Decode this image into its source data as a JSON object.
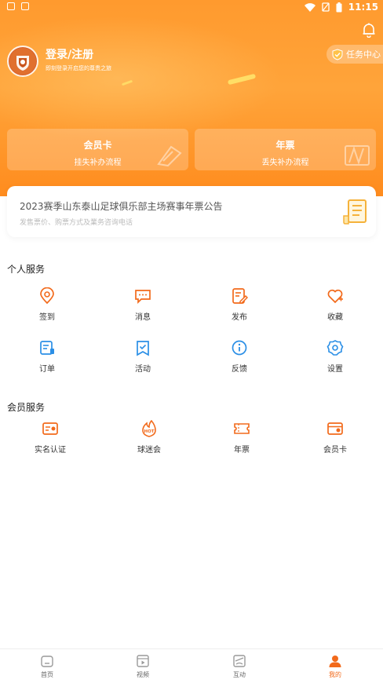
{
  "status_bar": {
    "time": "11:15"
  },
  "profile": {
    "login_label": "登录/注册",
    "subtitle": "即刻登录开启您的尊贵之旅"
  },
  "task_center": {
    "label": "任务中心"
  },
  "hero_cards": [
    {
      "title": "会员卡",
      "subtitle": "挂失补办流程"
    },
    {
      "title": "年票",
      "subtitle": "丢失补办流程"
    }
  ],
  "notice": {
    "title": "2023赛季山东泰山足球俱乐部主场赛事年票公告",
    "subtitle": "发售票价、购票方式及業务咨询电话"
  },
  "personal_services": {
    "title": "个人服务",
    "items": [
      {
        "label": "签到",
        "icon": "location-pin-icon"
      },
      {
        "label": "消息",
        "icon": "message-icon"
      },
      {
        "label": "发布",
        "icon": "edit-icon"
      },
      {
        "label": "收藏",
        "icon": "heart-icon"
      },
      {
        "label": "订单",
        "icon": "order-icon"
      },
      {
        "label": "活动",
        "icon": "bookmark-icon"
      },
      {
        "label": "反馈",
        "icon": "info-icon"
      },
      {
        "label": "设置",
        "icon": "gear-icon"
      }
    ]
  },
  "member_services": {
    "title": "会员服务",
    "items": [
      {
        "label": "实名认证",
        "icon": "id-card-icon"
      },
      {
        "label": "球迷会",
        "icon": "hot-icon"
      },
      {
        "label": "年票",
        "icon": "ticket-icon"
      },
      {
        "label": "会员卡",
        "icon": "member-card-icon"
      }
    ]
  },
  "bottom_nav": [
    {
      "label": "首页",
      "icon": "home-icon"
    },
    {
      "label": "视频",
      "icon": "video-icon"
    },
    {
      "label": "互动",
      "icon": "interact-icon"
    },
    {
      "label": "我的",
      "icon": "user-icon",
      "active": true
    }
  ],
  "colors": {
    "accent": "#f26a1b",
    "blue": "#2b8fe6",
    "hero": "#ff9a2e"
  }
}
